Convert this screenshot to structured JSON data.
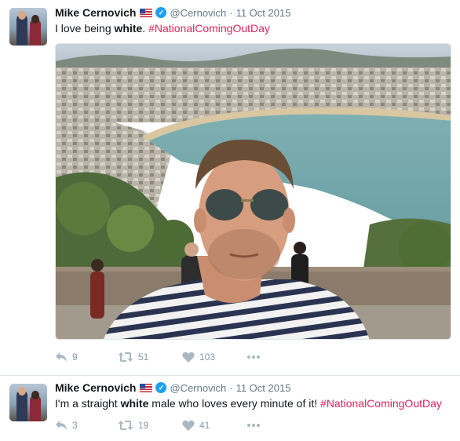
{
  "tweets": [
    {
      "author": {
        "name": "Mike Cernovich",
        "handle": "@Cernovich"
      },
      "date": "11 Oct 2015",
      "text": {
        "before": "I love being ",
        "bold": "white",
        "after": ". ",
        "hashtag": "#NationalComingOutDay"
      },
      "actions": {
        "replies": "9",
        "retweets": "51",
        "likes": "103"
      },
      "media": "selfie-photo"
    },
    {
      "author": {
        "name": "Mike Cernovich",
        "handle": "@Cernovich"
      },
      "date": "11 Oct 2015",
      "text": {
        "before": "I'm a straight ",
        "bold": "white",
        "after": " male who loves every minute of it! ",
        "hashtag": "#NationalComingOutDay"
      },
      "actions": {
        "replies": "3",
        "retweets": "19",
        "likes": "41"
      }
    }
  ],
  "separator": "·",
  "icons": [
    "flag-icon",
    "verified-icon",
    "reply-icon",
    "retweet-icon",
    "like-icon",
    "more-icon"
  ],
  "colors": {
    "hashtag": "#e0245e",
    "verified": "#1da1f2",
    "meta": "#657786",
    "action": "#aab8c2"
  }
}
